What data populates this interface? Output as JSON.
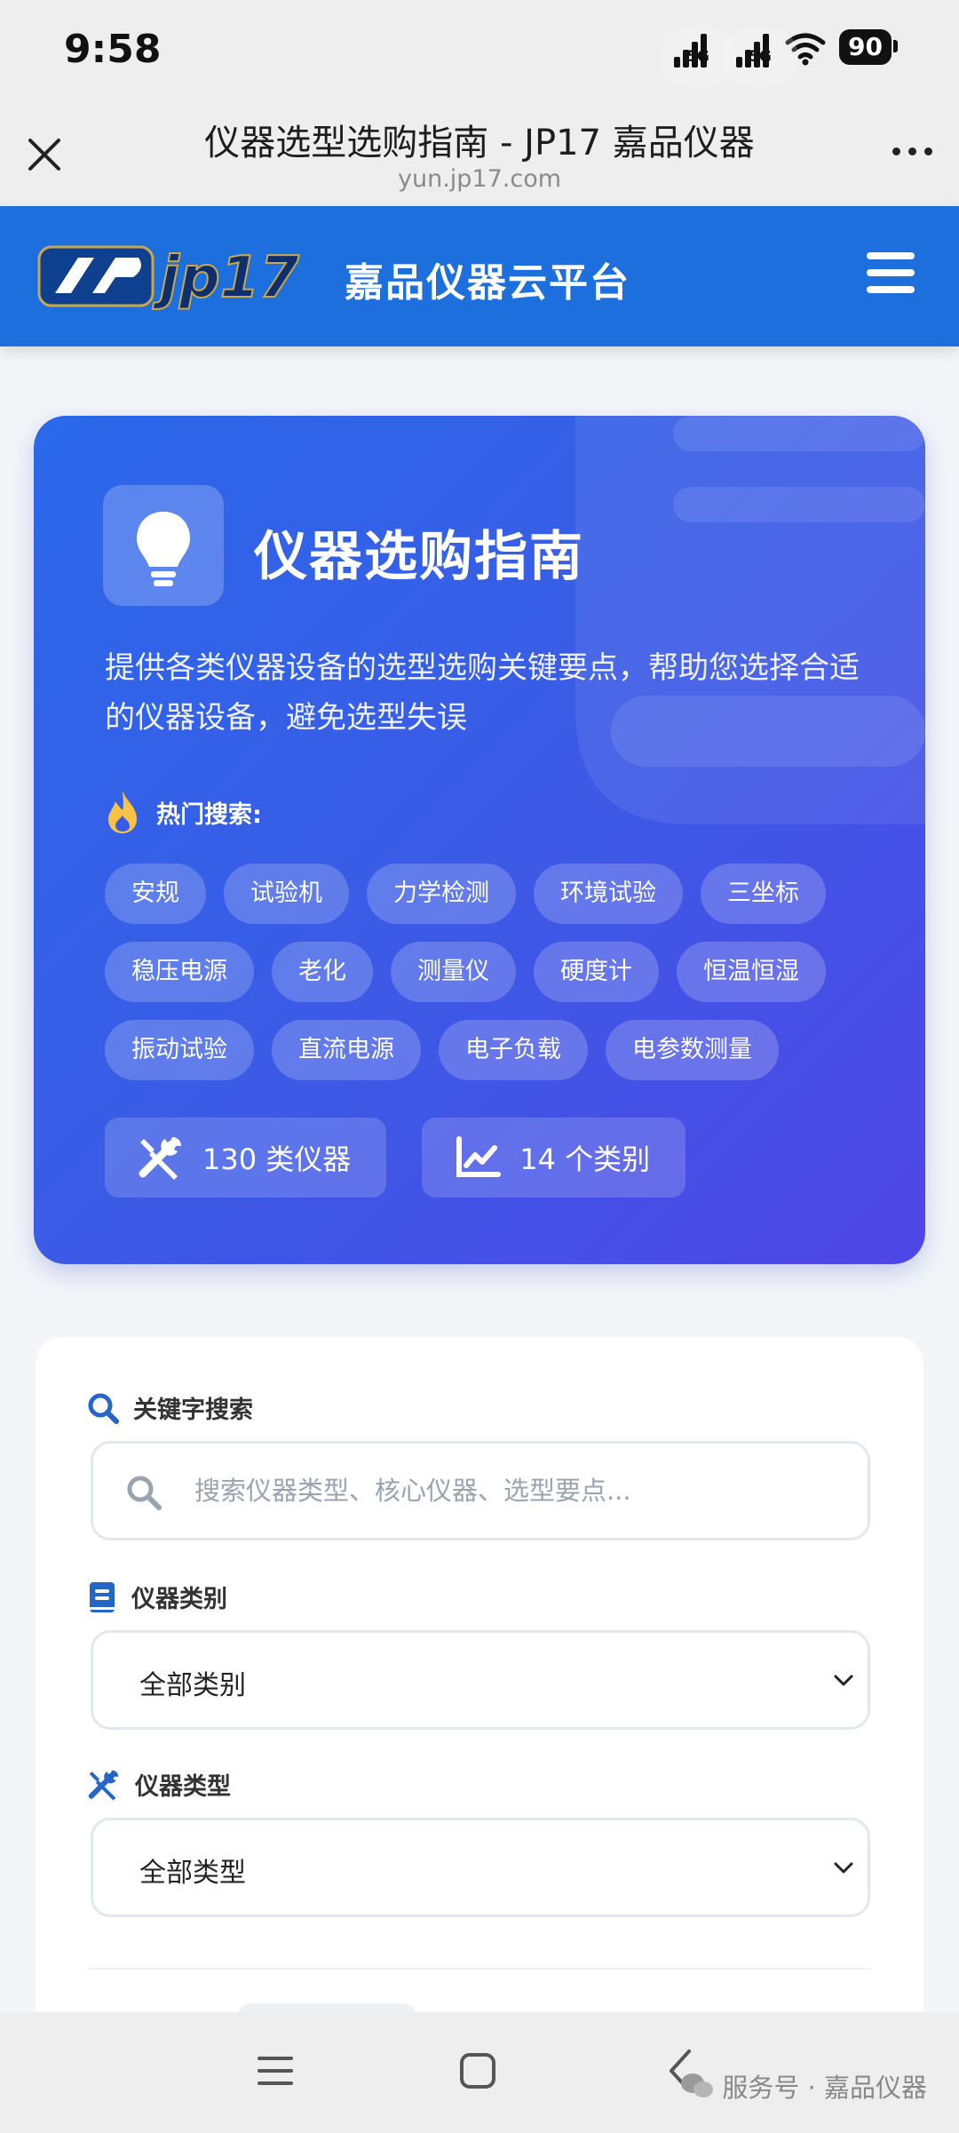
{
  "status_bar": {
    "time": "9:58",
    "signal_1": "5G",
    "signal_2": "5G",
    "battery": "90",
    "icons": [
      "signal-icon",
      "signal-icon",
      "wifi-icon",
      "battery-icon"
    ]
  },
  "browser": {
    "title": "仪器选型选购指南 - JP17 嘉品仪器",
    "url": "yun.jp17.com",
    "icons": [
      "close-icon",
      "more-icon"
    ]
  },
  "header": {
    "logo_text": "jp17",
    "platform_name": "嘉品仪器云平台",
    "brand_color": "#1d6fde",
    "icons": [
      "menu-icon"
    ]
  },
  "hero": {
    "title": "仪器选购指南",
    "description": "提供各类仪器设备的选型选购关键要点，帮助您选择合适的仪器设备，避免选型失误",
    "hot_label": "热门搜索:",
    "gradient": [
      "#2a68ea",
      "#4f46e5"
    ],
    "tag_rows": [
      [
        "安规",
        "试验机",
        "力学检测",
        "环境试验",
        "三坐标"
      ],
      [
        "稳压电源",
        "老化",
        "测量仪",
        "硬度计",
        "恒温恒湿"
      ],
      [
        "振动试验",
        "直流电源",
        "电子负载",
        "电参数测量"
      ]
    ],
    "stats": [
      {
        "label": "130 类仪器",
        "icon": "tools-icon"
      },
      {
        "label": "14 个类别",
        "icon": "chart-line-icon"
      }
    ],
    "icons": [
      "lightbulb-icon",
      "fire-icon"
    ]
  },
  "form": {
    "keyword": {
      "label": "关键字搜索",
      "placeholder": "搜索仪器类型、核心仪器、选型要点...",
      "value": "",
      "icon": "search-icon"
    },
    "category": {
      "label": "仪器类别",
      "value": "全部类别",
      "icon": "book-icon"
    },
    "type": {
      "label": "仪器类型",
      "value": "全部类型",
      "icon": "tools-icon"
    }
  },
  "bottom_nav": {
    "icons": [
      "menu-nav-icon",
      "home-square-icon",
      "back-icon"
    ],
    "watermark": "服务号 · 嘉品仪器"
  }
}
